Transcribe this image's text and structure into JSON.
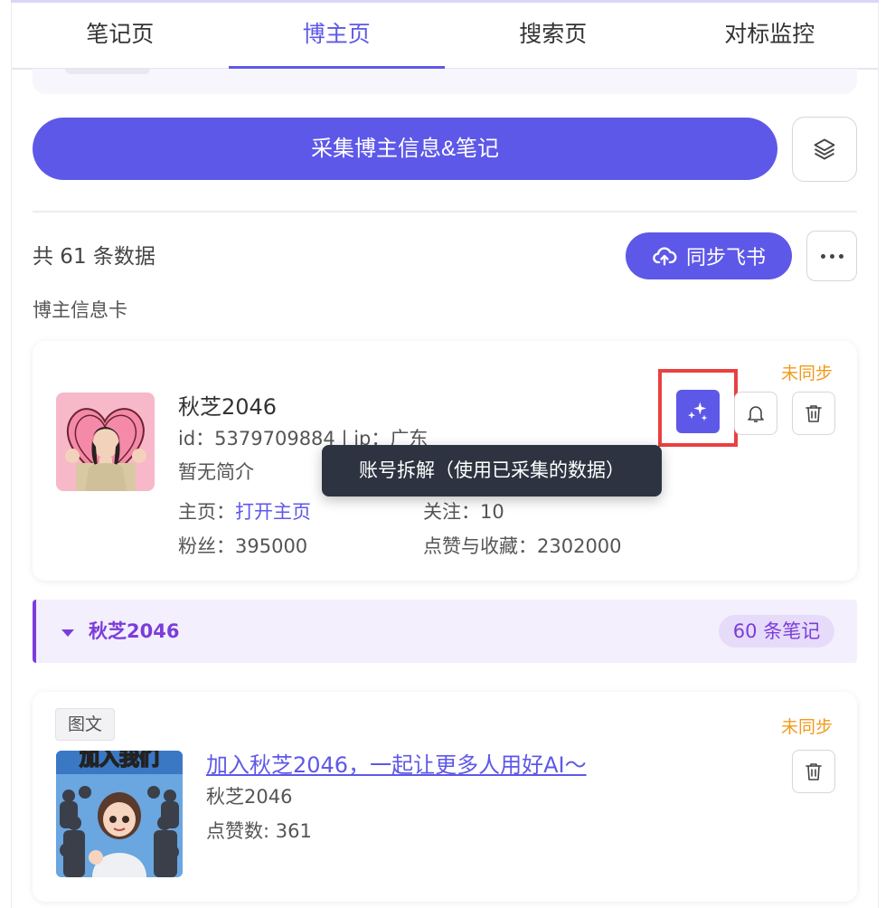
{
  "tabs": [
    {
      "label": "笔记页"
    },
    {
      "label": "博主页"
    },
    {
      "label": "搜索页"
    },
    {
      "label": "对标监控"
    }
  ],
  "collect_button": "采集博主信息&笔记",
  "total_text": "共 61 条数据",
  "sync_button": "同步飞书",
  "section_label": "博主信息卡",
  "blogger": {
    "status": "未同步",
    "name": "秋芝2046",
    "id_line": "id：5379709884 | ip：广东",
    "bio": "暂无简介",
    "homepage_label": "主页：",
    "homepage_link": "打开主页",
    "fans": "粉丝：395000",
    "following": "关注：10",
    "likes_collects": "点赞与收藏：2302000"
  },
  "tooltip": "账号拆解（使用已采集的数据）",
  "group": {
    "name": "秋芝2046",
    "count": "60 条笔记"
  },
  "note": {
    "tag": "图文",
    "status": "未同步",
    "title": "加入秋芝2046，一起让更多人用好AI～",
    "author": "秋芝2046",
    "likes": "点赞数: 361",
    "thumb_text": "加入我们"
  },
  "colors": {
    "accent": "#5e58e8",
    "status_orange": "#f29a1b",
    "group_purple": "#7c3cdb",
    "highlight_red": "#ea4040",
    "tooltip_bg": "#2d3340"
  },
  "icons": [
    "layers-icon",
    "cloud-upload-icon",
    "more-dots-icon",
    "sparkles-icon",
    "bell-icon",
    "trash-icon",
    "caret-down-icon"
  ]
}
